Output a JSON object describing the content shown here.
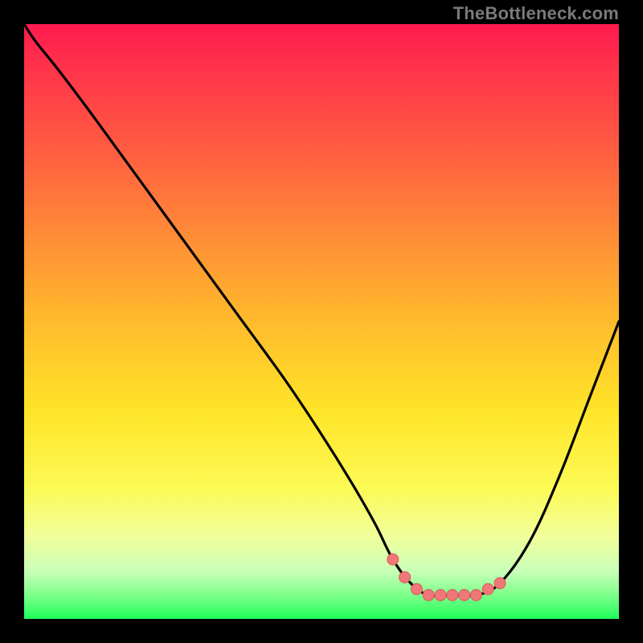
{
  "watermark": "TheBottleneck.com",
  "colors": {
    "curve": "#000000",
    "marker_fill": "#f07878",
    "marker_stroke": "#d85a5a",
    "gradient_top": "#ff1a4f",
    "gradient_bottom": "#1eff5a"
  },
  "chart_data": {
    "type": "line",
    "title": "",
    "xlabel": "",
    "ylabel": "",
    "xlim": [
      0,
      100
    ],
    "ylim": [
      0,
      100
    ],
    "grid": false,
    "legend": false,
    "series": [
      {
        "name": "bottleneck-curve",
        "x": [
          0,
          2,
          6,
          12,
          20,
          28,
          36,
          44,
          50,
          55,
          59,
          62,
          65,
          68,
          72,
          76,
          80,
          85,
          90,
          95,
          100
        ],
        "values": [
          100,
          97,
          92,
          84,
          73,
          62,
          51,
          40,
          31,
          23,
          16,
          10,
          6,
          4,
          4,
          4,
          6,
          13,
          24,
          37,
          50
        ]
      }
    ],
    "markers": {
      "name": "highlight-dots",
      "x": [
        62,
        64,
        66,
        68,
        70,
        72,
        74,
        76,
        78,
        80
      ],
      "values": [
        10,
        7,
        5,
        4,
        4,
        4,
        4,
        4,
        5,
        6
      ]
    },
    "annotations": []
  }
}
